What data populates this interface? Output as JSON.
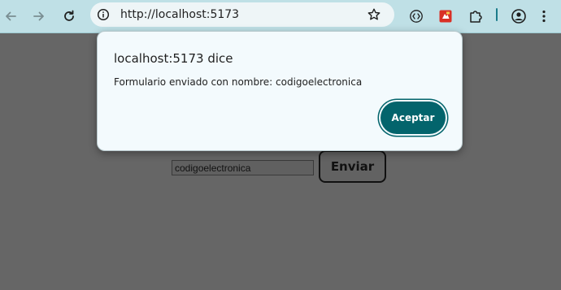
{
  "browser": {
    "url": "http://localhost:5173",
    "icons": {
      "back": "arrow-left-icon",
      "forward": "arrow-right-icon",
      "reload": "reload-icon",
      "site_info": "info-icon",
      "bookmark": "star-icon",
      "extension1": "code-bracket-icon",
      "extension2": "red-box-extension-icon",
      "extensions_menu": "puzzle-icon",
      "profile": "profile-icon",
      "menu": "kebab-menu-icon"
    },
    "colors": {
      "toolbar": "#bfe0e6",
      "omnibox": "#eef5f7"
    }
  },
  "dialog": {
    "title": "localhost:5173 dice",
    "message": "Formulario enviado con nombre: codigoelectronica",
    "accept_label": "Aceptar",
    "colors": {
      "background": "#f3fafd",
      "button": "#03646c"
    }
  },
  "form": {
    "name_value": "codigoelectronica",
    "submit_label": "Enviar"
  },
  "page": {
    "overlay_color": "#666666"
  }
}
